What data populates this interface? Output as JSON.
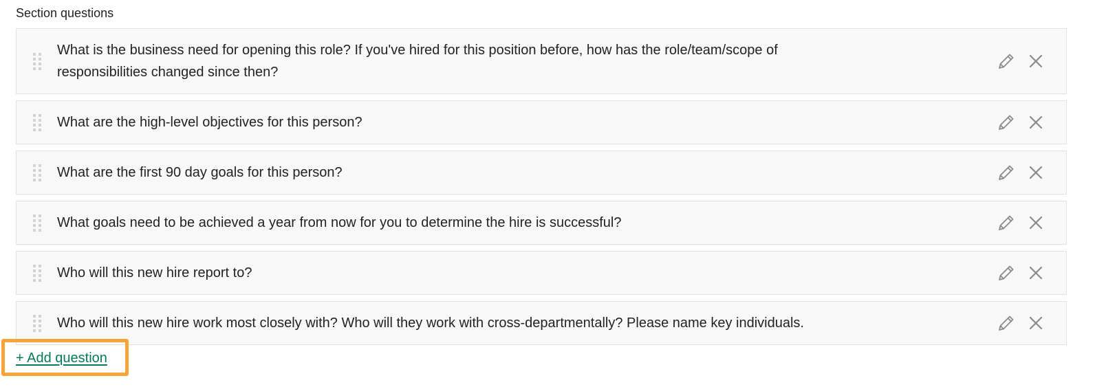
{
  "section": {
    "label": "Section questions"
  },
  "questions": [
    {
      "text": "What is the business need for opening this role? If you've hired for this position before, how has the role/team/scope of responsibilities changed since then?"
    },
    {
      "text": "What are the high-level objectives for this person?"
    },
    {
      "text": "What are the first 90 day goals for this person?"
    },
    {
      "text": "What goals need to be achieved a year from now for you to determine the hire is successful?"
    },
    {
      "text": "Who will this new hire report to?"
    },
    {
      "text": "Who will this new hire work most closely with? Who will they work with cross-departmentally? Please name key individuals."
    }
  ],
  "icons": {
    "drag": "drag-handle-icon",
    "edit": "pencil-icon",
    "delete": "close-icon"
  },
  "actions": {
    "add_question_label": "+ Add question"
  },
  "colors": {
    "link": "#047a57",
    "highlight": "#f9a438",
    "row_background": "#f8f8f8",
    "row_border": "#e1e1e1",
    "icon": "#8a8a8a"
  }
}
